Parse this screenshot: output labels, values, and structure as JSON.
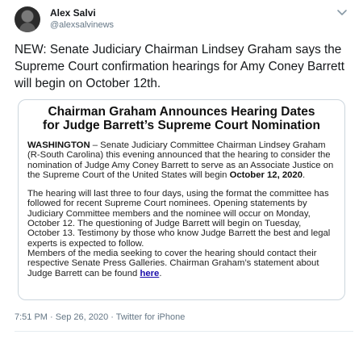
{
  "author": {
    "display_name": "Alex Salvi",
    "handle": "@alexsalvinews"
  },
  "tweet_text": "NEW: Senate Judiciary Chairman Lindsey Graham says the Supreme Court confirmation hearings for Amy Coney Barrett will begin on October 12th.",
  "release": {
    "title_line1": "Chairman Graham Announces Hearing Dates",
    "title_line2": "for Judge Barrett’s Supreme Court Nomination",
    "p1_dateline": "WASHINGTON",
    "p1_body": " – Senate Judiciary Committee Chairman Lindsey Graham (R-South Carolina) this evening announced that the hearing to consider the nomination of Judge Amy Coney Barrett to serve as an Associate Justice on the Supreme Court of the United States will begin ",
    "p1_date": "October 12, 2020",
    "p1_end": ".",
    "p2_body": "The hearing will last three to four days, using the format the committee has followed for recent Supreme Court nominees. Opening statements by Judiciary Committee members and the nominee will occur on Monday, October 12. The questioning of Judge Barrett will begin on Tuesday, October 13. Testimony by those who know Judge Barrett the best and legal experts is expected to follow.",
    "p3_body": "Members of the media seeking to cover the hearing should contact their respective Senate Press Galleries. Chairman Graham’s statement about Judge Barrett can be found ",
    "p3_link": "here",
    "p3_end": "."
  },
  "meta": "7:51 PM · Sep 26, 2020 · Twitter for iPhone",
  "icons": {
    "avatar": "avatar",
    "caret": "chevron-down-icon"
  },
  "colors": {
    "handle": "#657786",
    "link": "#1a0dab",
    "border": "#ccd6dd"
  }
}
